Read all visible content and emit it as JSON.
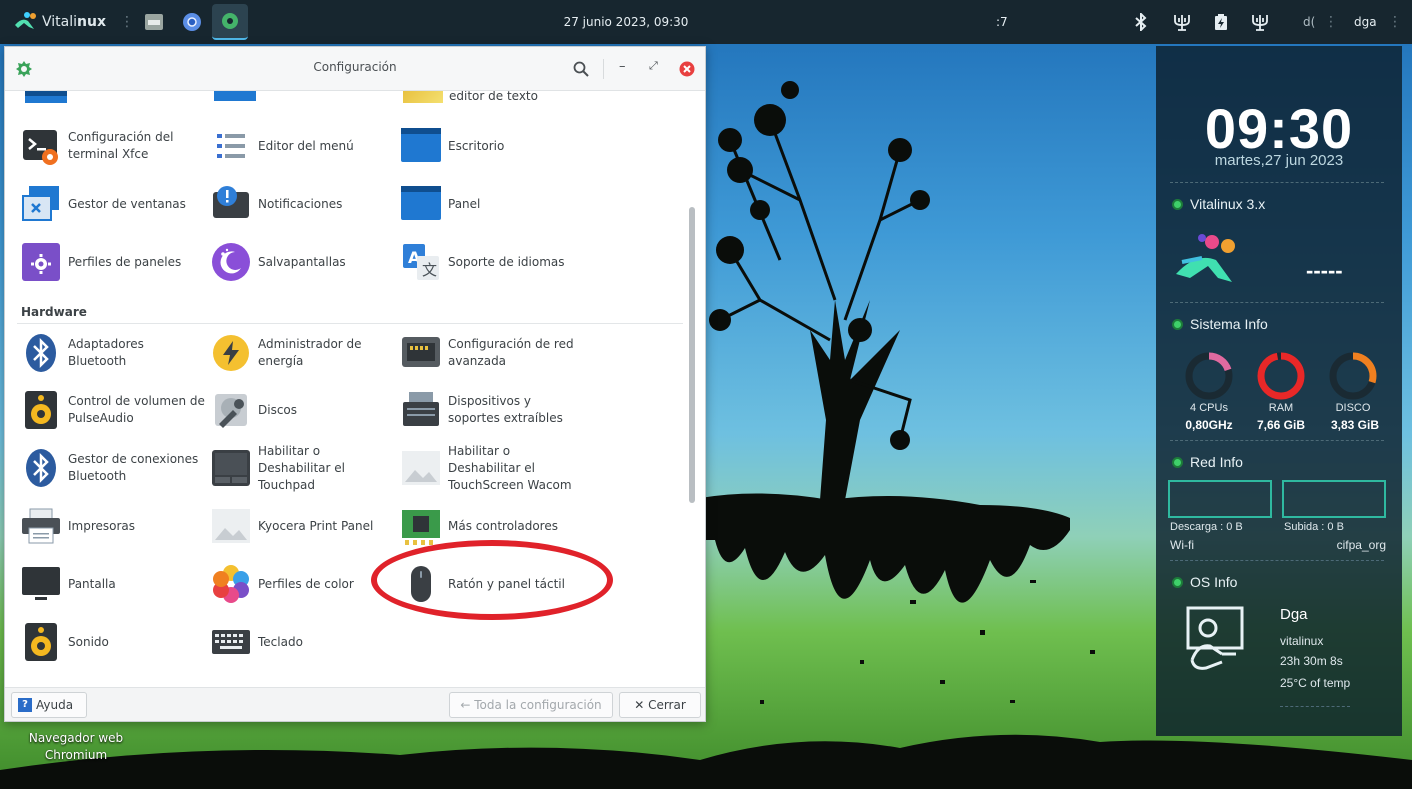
{
  "top_panel": {
    "logo_word_plain": "Vitali",
    "logo_word_bold": "nux",
    "datetime": "27 junio 2023, 09:30",
    "center_fragment": ":7",
    "user_fragment": "d(",
    "user": "dga",
    "icons": [
      "vitalinux-logo-icon",
      "file-manager-icon",
      "chromium-icon",
      "settings-icon",
      "bluetooth-icon",
      "network-icon",
      "battery-icon",
      "network-icon"
    ]
  },
  "window": {
    "title": "Configuración",
    "icons": [
      "search-icon",
      "minimize-icon",
      "maximize-icon",
      "close-icon"
    ],
    "top_items": [
      {
        "label": "Configuración del terminal Xfce",
        "icon": "terminal-icon"
      },
      {
        "label": "Editor del menú",
        "icon": "menu-editor-icon"
      },
      {
        "label": "Escritorio",
        "icon": "desktop-icon"
      },
      {
        "label": "Gestor de ventanas",
        "icon": "window-manager-icon"
      },
      {
        "label": "Notificaciones",
        "icon": "notifications-icon"
      },
      {
        "label": "Panel",
        "icon": "panel-icon"
      },
      {
        "label": "Perfiles de paneles",
        "icon": "panel-profiles-icon"
      },
      {
        "label": "Salvapantallas",
        "icon": "screensaver-icon"
      },
      {
        "label": "Soporte de idiomas",
        "icon": "language-icon"
      }
    ],
    "cut_off_label": "editor de texto",
    "hardware_title": "Hardware",
    "hardware_items": [
      {
        "label": "Adaptadores Bluetooth",
        "icon": "bluetooth-icon"
      },
      {
        "label": "Administrador de energía",
        "icon": "power-icon"
      },
      {
        "label": "Configuración de red avanzada",
        "icon": "network-config-icon"
      },
      {
        "label": "Control de volumen de PulseAudio",
        "icon": "speaker-icon"
      },
      {
        "label": "Discos",
        "icon": "disks-icon"
      },
      {
        "label": "Dispositivos y soportes extraíbles",
        "icon": "removable-drive-icon"
      },
      {
        "label": "Gestor de conexiones Bluetooth",
        "icon": "bluetooth-icon"
      },
      {
        "label": "Habilitar o Deshabilitar el Touchpad",
        "icon": "touchpad-icon"
      },
      {
        "label": "Habilitar o Deshabilitar el TouchScreen Wacom",
        "icon": "image-placeholder-icon"
      },
      {
        "label": "Impresoras",
        "icon": "printer-icon"
      },
      {
        "label": "Kyocera Print Panel",
        "icon": "image-placeholder-icon"
      },
      {
        "label": "Más controladores",
        "icon": "chip-icon"
      },
      {
        "label": "Pantalla",
        "icon": "display-icon"
      },
      {
        "label": "Perfiles de color",
        "icon": "color-profiles-icon"
      },
      {
        "label": "Ratón y panel táctil",
        "icon": "mouse-icon"
      },
      {
        "label": "Sonido",
        "icon": "speaker-icon"
      },
      {
        "label": "Teclado",
        "icon": "keyboard-icon"
      }
    ],
    "bottom": {
      "help_label": "Ayuda",
      "all_settings_label": "← Toda la configuración",
      "close_label": "✕ Cerrar"
    }
  },
  "conky": {
    "time": "09:30",
    "date": "martes,27 jun 2023",
    "os_title": "Vitalinux 3.x",
    "os_dashes": "-----",
    "system_title": "Sistema Info",
    "gauges": [
      {
        "label": "4 CPUs",
        "value": "0,80GHz",
        "fraction": 0.2,
        "color": "#e06aa0"
      },
      {
        "label": "RAM",
        "value": "7,66 GiB",
        "fraction": 0.97,
        "color": "#e82828"
      },
      {
        "label": "DISCO",
        "value": "3,83 GiB",
        "fraction": 0.3,
        "color": "#f08020"
      }
    ],
    "network_title": "Red Info",
    "download": "Descarga : 0 B",
    "upload": "Subida : 0 B",
    "iface": "Wi-fi",
    "ssid": "cifpa_org",
    "osinfo_title": "OS Info",
    "osinfo_name": "Dga",
    "osinfo_host": "vitalinux",
    "osinfo_uptime": "23h 30m 8s",
    "osinfo_temp": "25°C of temp"
  },
  "desktop": {
    "launcher_label_line1": "Navegador web",
    "launcher_label_line2": "Chromium"
  }
}
